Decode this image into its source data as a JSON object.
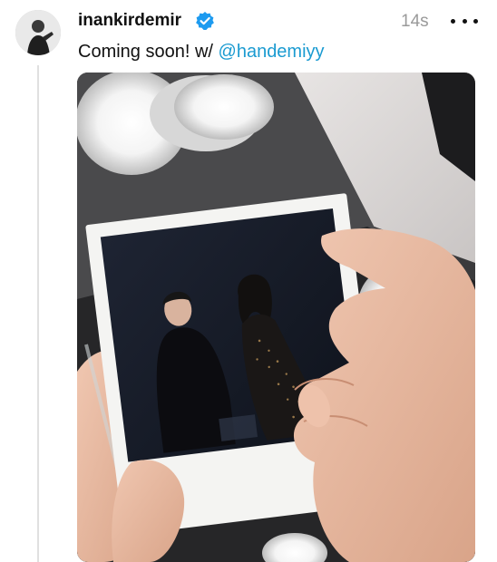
{
  "post": {
    "username": "inankirdemir",
    "verified": true,
    "timestamp": "14s",
    "caption_text": "Coming soon! w/ ",
    "mention": "@handemiyy"
  },
  "icons": {
    "verified": "verified-badge-icon",
    "more": "more-options-icon"
  },
  "colors": {
    "verified_badge": "#1d9bf0",
    "mention": "#1b9bd1",
    "timestamp": "#9a9a9a"
  }
}
